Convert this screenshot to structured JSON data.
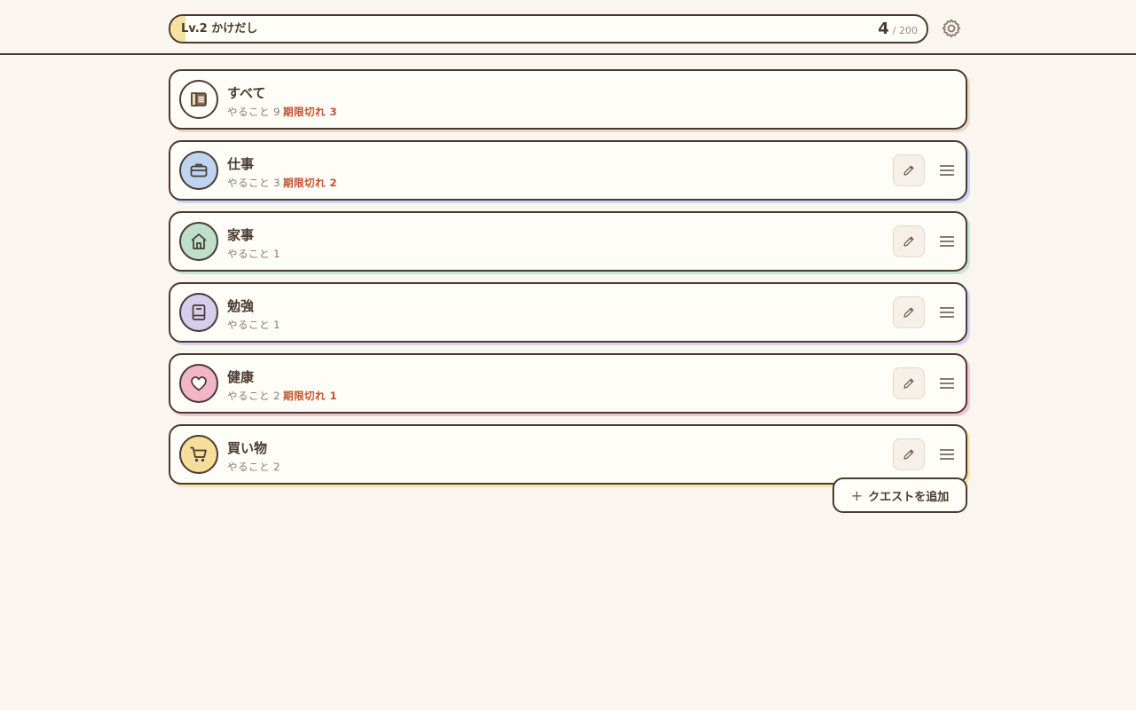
{
  "header": {
    "level_label": "Lv.2 かけだし",
    "xp_current": "4",
    "xp_separator": "/",
    "xp_max": "200",
    "xp_progress": 0.02,
    "settings_icon": "gear-icon"
  },
  "quests": [
    {
      "name": "すべて",
      "count_label": "やること 9",
      "overdue_label": "期限切れ 3",
      "icon": "list-icon",
      "icon_bg": "#fffdf8",
      "shadow": "#e8d9c6",
      "editable": false
    },
    {
      "name": "仕事",
      "count_label": "やること 3",
      "overdue_label": "期限切れ 2",
      "icon": "briefcase-icon",
      "icon_bg": "#bed4f0",
      "shadow": "#c5d8f1",
      "editable": true
    },
    {
      "name": "家事",
      "count_label": "やること 1",
      "overdue_label": "",
      "icon": "home-icon",
      "icon_bg": "#bde0cc",
      "shadow": "#c7e5d2",
      "editable": true
    },
    {
      "name": "勉強",
      "count_label": "やること 1",
      "overdue_label": "",
      "icon": "book-icon",
      "icon_bg": "#d6cdef",
      "shadow": "#dad1f1",
      "editable": true
    },
    {
      "name": "健康",
      "count_label": "やること 2",
      "overdue_label": "期限切れ 1",
      "icon": "heart-icon",
      "icon_bg": "#f3b6c8",
      "shadow": "#f3c4d2",
      "editable": true
    },
    {
      "name": "買い物",
      "count_label": "やること 2",
      "overdue_label": "",
      "icon": "cart-icon",
      "icon_bg": "#f6dd9a",
      "shadow": "#f8e3a6",
      "editable": true
    }
  ],
  "add_quest": {
    "plus": "+",
    "label": "クエストを追加"
  },
  "colors": {
    "background": "#faf5ef",
    "ink": "#4a3a30",
    "overdue": "#c0502e",
    "xp_fill": "#f6e0a2"
  }
}
